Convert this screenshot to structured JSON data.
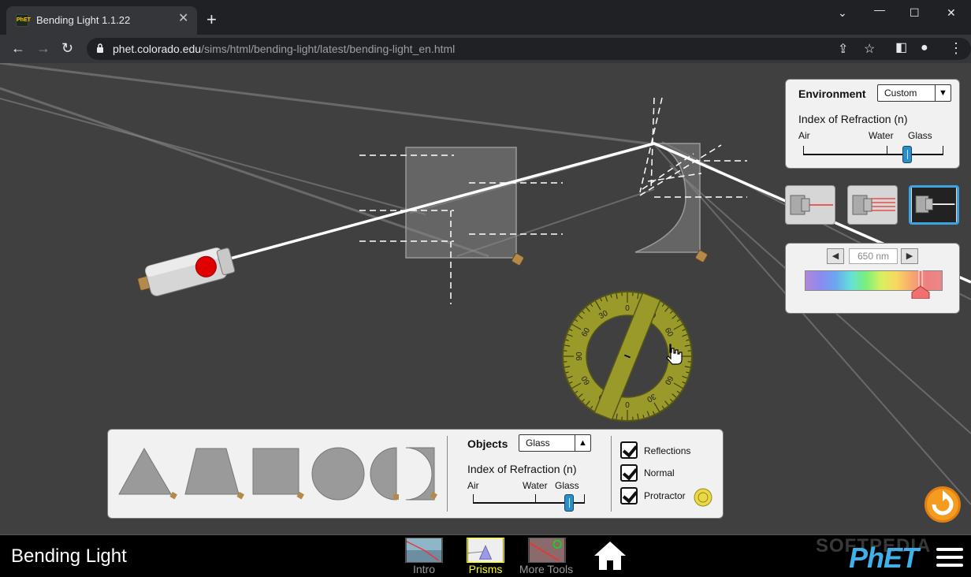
{
  "browser": {
    "tab_title": "Bending Light 1.1.22",
    "url_host": "phet.colorado.edu",
    "url_path": "/sims/html/bending-light/latest/bending-light_en.html"
  },
  "environment_panel": {
    "title": "Environment",
    "selected": "Custom",
    "ior_label": "Index of Refraction (n)",
    "ticks": [
      "Air",
      "Water",
      "Glass"
    ],
    "slider_value": 0.74
  },
  "wavelength": {
    "value": "650 nm",
    "slider_value": 0.84
  },
  "objects_panel": {
    "title": "Objects",
    "selected": "Glass",
    "ior_label": "Index of Refraction (n)",
    "ticks": [
      "Air",
      "Water",
      "Glass"
    ],
    "slider_value": 0.86,
    "shapes": [
      "triangle",
      "trapezoid",
      "square",
      "circle",
      "semicircle"
    ]
  },
  "options": {
    "reflections": "Reflections",
    "normal": "Normal",
    "protractor": "Protractor"
  },
  "protractor_labels": [
    "0",
    "30",
    "60",
    "90",
    "60",
    "30",
    "0",
    "30",
    "60",
    "90",
    "60",
    "30"
  ],
  "navbar": {
    "sim_title": "Bending Light",
    "screens": [
      "Intro",
      "Prisms",
      "More Tools"
    ],
    "selected_screen": "Prisms",
    "brand": "PhET"
  },
  "watermark": "SOFTPEDIA",
  "colors": {
    "sim_bg": "#404040",
    "accent_selected": "#ffff00",
    "slider_thumb": "#2a8ec9",
    "reset": "#f39c1f"
  }
}
